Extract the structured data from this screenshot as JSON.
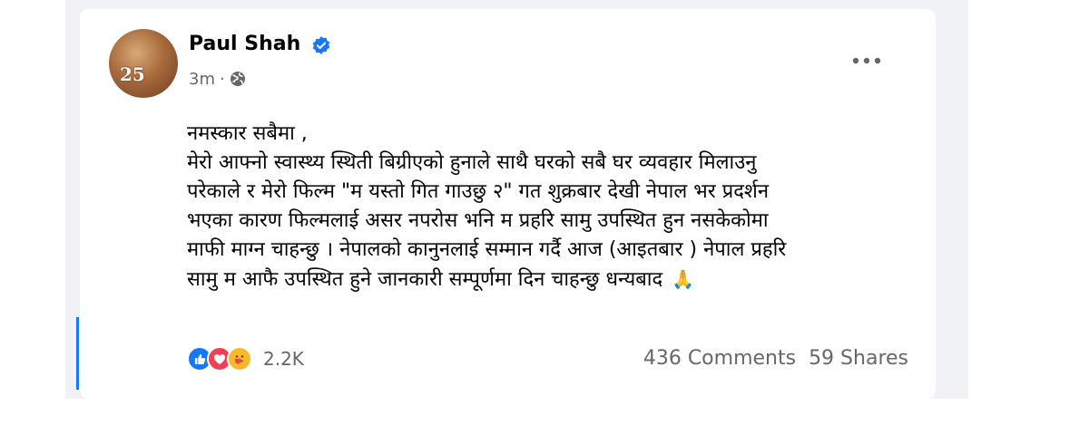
{
  "post": {
    "author": "Paul Shah",
    "time": "3m",
    "separator": "·",
    "avatar_text": "25",
    "text_lines": [
      "नमस्कार सबैमा ,",
      "मेरो आफ्नो स्वास्थ्य स्थिती बिग्रीएको हुनाले साथै घरको सबै घर व्यवहार मिलाउनु",
      "परेकाले र मेरो फिल्म \"म यस्तो गित गाउछु २\" गत शुक्रबार देखी नेपाल भर प्रदर्शन",
      "भएका कारण फिल्मलाई असर नपरोस भनि म प्रहरि सामु उपस्थित हुन नसकेकोमा",
      "माफी माग्न चाहन्छु । नेपालको कानुनलाई सम्मान गर्दै आज (आइतबार ) नेपाल प्रहरि",
      "सामु म आफै उपस्थित हुने जानकारी सम्पूर्णमा दिन चाहन्छु धन्यबाद"
    ],
    "emoji": "🙏",
    "reactions": {
      "icons": [
        "like-icon",
        "love-icon",
        "care-icon"
      ],
      "count": "2.2K"
    },
    "comments": "436 Comments",
    "shares": "59 Shares"
  },
  "colors": {
    "like": "#1877f2",
    "love": "#f33e58",
    "care": "#f7b928",
    "verified": "#1877f2"
  }
}
